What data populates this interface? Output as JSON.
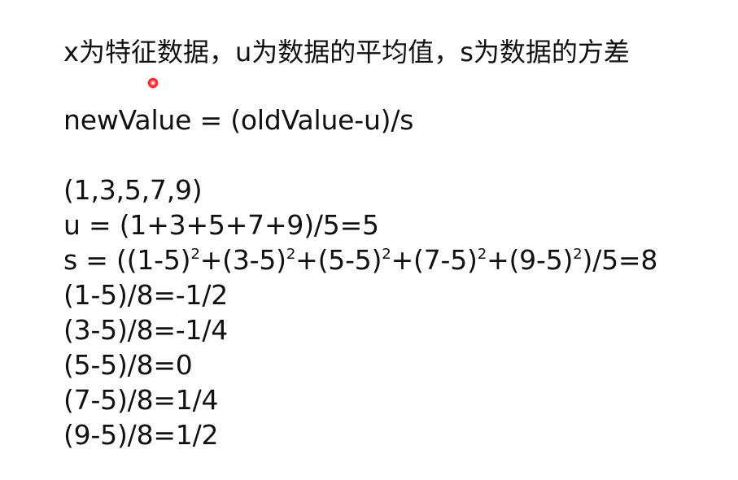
{
  "title": "x为特征数据，u为数据的平均值，s为数据的方差",
  "formula": "newValue = (oldValue-u)/s",
  "example": {
    "data": "(1,3,5,7,9)",
    "mean": "u = (1+3+5+7+9)/5=5",
    "variance_parts": [
      "s = ((1-5)",
      "2",
      "+(3-5)",
      "2",
      "+(5-5)",
      "2",
      "+(7-5)",
      "2",
      "+(9-5)",
      "2",
      ")/5=8"
    ],
    "results": [
      "(1-5)/8=-1/2",
      "(3-5)/8=-1/4",
      "(5-5)/8=0",
      "(7-5)/8=1/4",
      "(9-5)/8=1/2"
    ]
  },
  "colors": {
    "text": "#111111",
    "background": "#ffffff",
    "pointer": "#e8232a"
  },
  "icons": {
    "pointer": "laser-pointer-dot-icon"
  }
}
